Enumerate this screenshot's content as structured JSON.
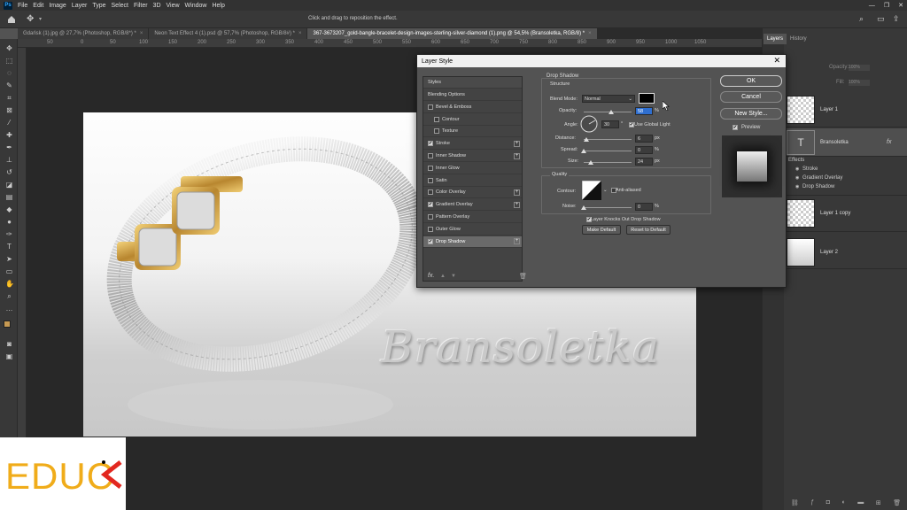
{
  "menubar": {
    "items": [
      "File",
      "Edit",
      "Image",
      "Layer",
      "Type",
      "Select",
      "Filter",
      "3D",
      "View",
      "Window",
      "Help"
    ]
  },
  "options": {
    "hint": "Click and drag to reposition the effect."
  },
  "tabs": [
    {
      "label": "Gdańsk (1).jpg @ 27,7% (Photoshop, RGB/8*) *"
    },
    {
      "label": "Neon Text Effect 4 (1).psd @ 57,7% (Photoshop, RGB/8#) *"
    },
    {
      "label": "367-3673207_gold-bangle-bracelet-design-images-sterling-silver-diamond (1).png @ 54,5% (Bransoletka, RGB/8) *"
    }
  ],
  "ruler": {
    "ticks": [
      "50",
      "0",
      "50",
      "100",
      "150",
      "200",
      "250",
      "300",
      "350",
      "400",
      "450",
      "500",
      "550",
      "600",
      "650",
      "700",
      "750",
      "800",
      "850",
      "900",
      "950",
      "1000",
      "1050"
    ]
  },
  "canvas": {
    "text": "Bransoletka"
  },
  "panels": {
    "tabs": [
      "Layers",
      "History"
    ],
    "opacity_label": "Opacity:",
    "opacity_value": "100%",
    "fill_label": "Fill:",
    "fill_value": "100%",
    "layers": [
      {
        "name": "Layer 1"
      },
      {
        "name": "Bransoletka",
        "fx": "fx"
      },
      {
        "name": "Layer 1 copy"
      },
      {
        "name": "Layer 2"
      }
    ],
    "effects_label": "Effects",
    "effects": [
      "Stroke",
      "Gradient Overlay",
      "Drop Shadow"
    ]
  },
  "dialog": {
    "title": "Layer Style",
    "close": "✕",
    "styles_header": "Styles",
    "styles": [
      {
        "label": "Blending Options",
        "checkbox": false,
        "checked": false,
        "plus": false
      },
      {
        "label": "Bevel & Emboss",
        "checkbox": true,
        "checked": false,
        "plus": false
      },
      {
        "label": "Contour",
        "checkbox": true,
        "checked": false,
        "plus": false,
        "indent": true
      },
      {
        "label": "Texture",
        "checkbox": true,
        "checked": false,
        "plus": false,
        "indent": true
      },
      {
        "label": "Stroke",
        "checkbox": true,
        "checked": true,
        "plus": true
      },
      {
        "label": "Inner Shadow",
        "checkbox": true,
        "checked": false,
        "plus": true
      },
      {
        "label": "Inner Glow",
        "checkbox": true,
        "checked": false,
        "plus": false
      },
      {
        "label": "Satin",
        "checkbox": true,
        "checked": false,
        "plus": false
      },
      {
        "label": "Color Overlay",
        "checkbox": true,
        "checked": false,
        "plus": true
      },
      {
        "label": "Gradient Overlay",
        "checkbox": true,
        "checked": true,
        "plus": true
      },
      {
        "label": "Pattern Overlay",
        "checkbox": true,
        "checked": false,
        "plus": false
      },
      {
        "label": "Outer Glow",
        "checkbox": true,
        "checked": false,
        "plus": false
      },
      {
        "label": "Drop Shadow",
        "checkbox": true,
        "checked": true,
        "plus": true,
        "selected": true
      }
    ],
    "fx": "fx.",
    "section_title": "Drop Shadow",
    "structure": "Structure",
    "blend_mode_label": "Blend Mode:",
    "blend_mode_value": "Normal",
    "shadow_color": "#000000",
    "opacity_label": "Opacity:",
    "opacity_value": "58",
    "opacity_level": 0.58,
    "angle_label": "Angle:",
    "angle_value": "30",
    "deg": "°",
    "use_global_light": "Use Global Light",
    "distance_label": "Distance:",
    "distance_value": "6",
    "spread_label": "Spread:",
    "spread_value": "0",
    "size_label": "Size:",
    "size_value": "24",
    "px": "px",
    "pct": "%",
    "quality": "Quality",
    "contour_label": "Contour:",
    "anti_aliased": "Anti-aliased",
    "noise_label": "Noise:",
    "noise_value": "0",
    "knockout": "Layer Knocks Out Drop Shadow",
    "make_default": "Make Default",
    "reset_default": "Reset to Default",
    "ok": "OK",
    "cancel": "Cancel",
    "new_style": "New Style...",
    "preview": "Preview"
  },
  "watermark": {
    "text": "EDUC"
  }
}
